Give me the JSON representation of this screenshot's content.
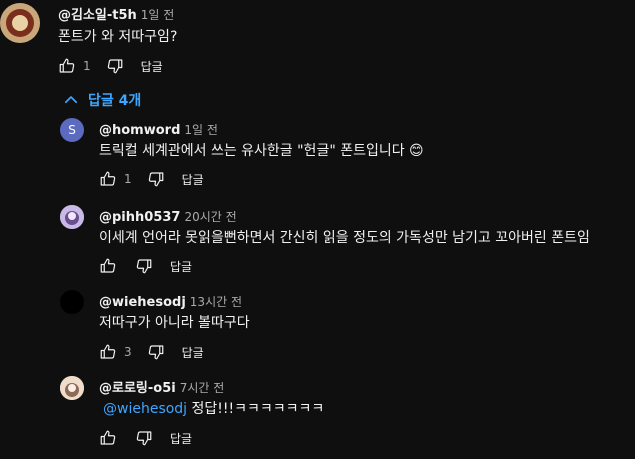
{
  "comments": [
    {
      "handle": "@김소일-t5h",
      "time": "1일 전",
      "text": "폰트가 와 저따구임?",
      "likes": "1",
      "reply_label": "답글"
    }
  ],
  "replies_toggle": {
    "label": "답글 4개",
    "icon": "chevron-up-icon"
  },
  "replies": [
    {
      "avatar_letter": "S",
      "avatar_color": "#5c6bc0",
      "handle": "@homword",
      "time": "1일 전",
      "text": "트릭컬 세계관에서 쓰는 유사한글 \"헌글\" 폰트입니다 😊",
      "likes": "1",
      "reply_label": "답글"
    },
    {
      "handle": "@pihh0537",
      "time": "20시간 전",
      "text": "이세계 언어라 못읽을뻔하면서 간신히 읽을 정도의 가독성만 남기고 꼬아버린 폰트임",
      "likes": "",
      "reply_label": "답글"
    },
    {
      "handle": "@wiehesodj",
      "time": "13시간 전",
      "text": "저따구가 아니라 볼따구다",
      "likes": "3",
      "reply_label": "답글"
    },
    {
      "handle": "@로로링-o5i",
      "time": "7시간 전",
      "mention": "@wiehesodj",
      "text": " 정답!!!ㅋㅋㅋㅋㅋㅋㅋ",
      "likes": "",
      "reply_label": "답글"
    }
  ],
  "colors": {
    "background": "#0f0f0f",
    "text": "#f1f1f1",
    "secondary": "#aaaaaa",
    "link": "#3ea6ff"
  }
}
